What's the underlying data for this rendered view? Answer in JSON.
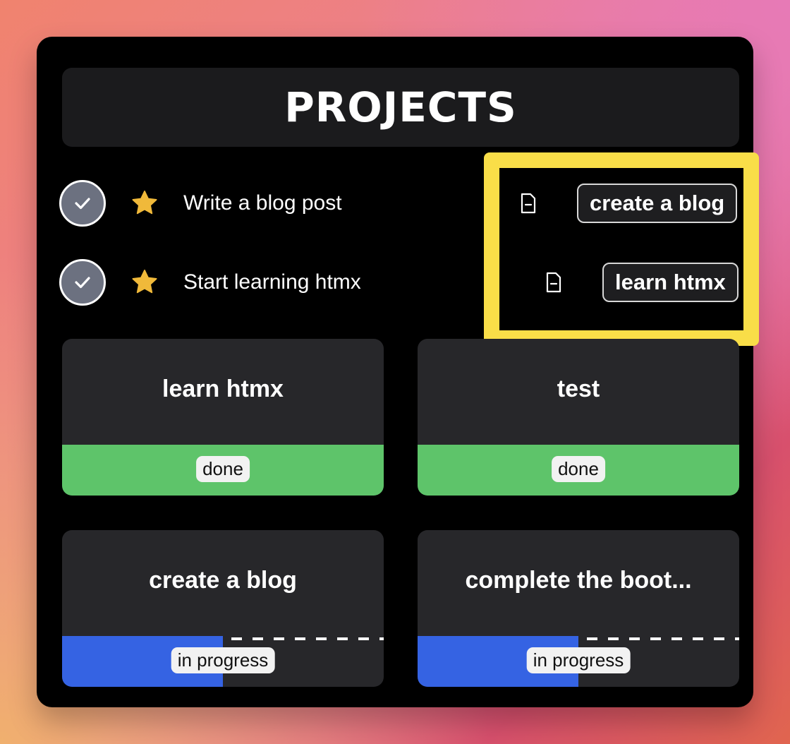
{
  "title": "PROJECTS",
  "colors": {
    "highlight": "#f9de48",
    "done": "#5ec46a",
    "in_progress": "#3563e3",
    "star": "#f0b93a",
    "check_bg": "#6c7180"
  },
  "tasks": [
    {
      "label": "Write a blog post",
      "icon": "star-icon",
      "checked": true
    },
    {
      "label": "Start learning htmx",
      "icon": "star-icon",
      "checked": true
    }
  ],
  "tags": [
    {
      "label": "create a blog",
      "icon": "document-icon"
    },
    {
      "label": "learn htmx",
      "icon": "document-icon"
    }
  ],
  "projects": [
    {
      "name": "learn htmx",
      "status": "done",
      "progress": 1.0
    },
    {
      "name": "test",
      "status": "done",
      "progress": 1.0
    },
    {
      "name": "create a blog",
      "status": "in progress",
      "progress": 0.5
    },
    {
      "name": "complete the boot...",
      "status": "in progress",
      "progress": 0.5
    }
  ]
}
